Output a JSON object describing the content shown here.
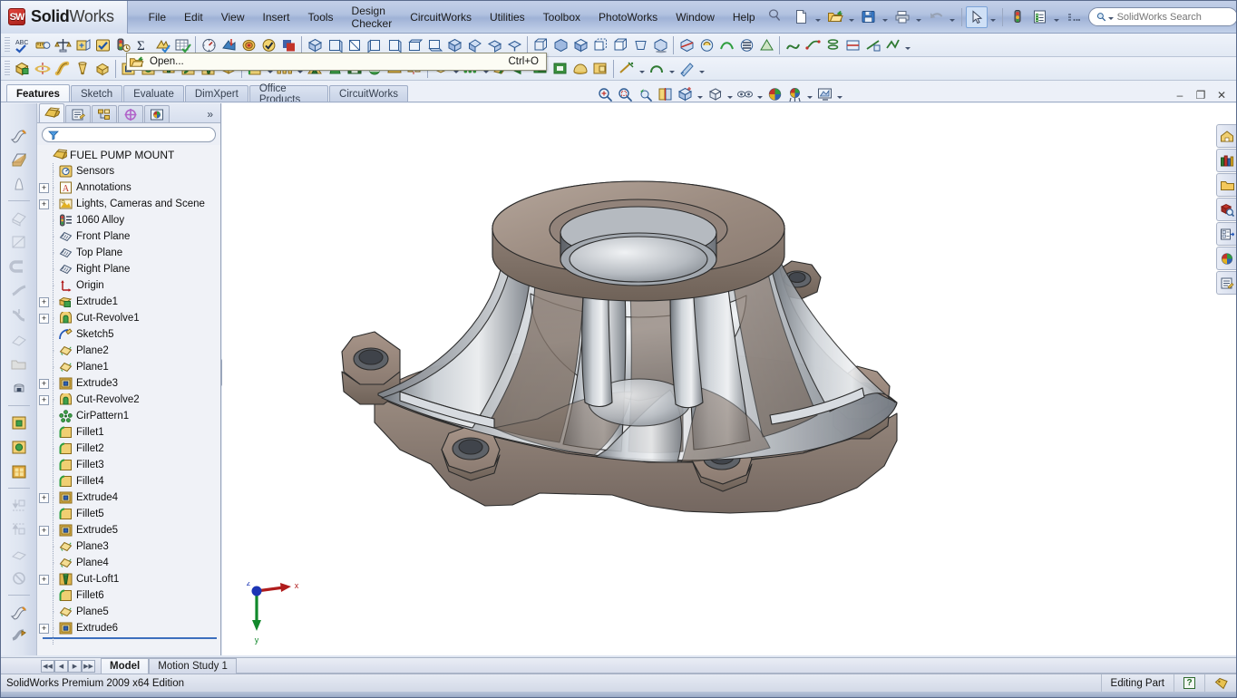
{
  "app": {
    "brand_bold": "Solid",
    "brand_light": "Works",
    "badge": "SW",
    "edition": "SolidWorks Premium 2009 x64 Edition"
  },
  "menubar": {
    "items": [
      {
        "label": "File"
      },
      {
        "label": "Edit"
      },
      {
        "label": "View"
      },
      {
        "label": "Insert"
      },
      {
        "label": "Tools"
      },
      {
        "label": "Design Checker"
      },
      {
        "label": "CircuitWorks"
      },
      {
        "label": "Utilities"
      },
      {
        "label": "Toolbox"
      },
      {
        "label": "PhotoWorks"
      },
      {
        "label": "Window"
      },
      {
        "label": "Help"
      }
    ]
  },
  "search": {
    "placeholder": "SolidWorks Search",
    "value": ""
  },
  "window_controls": {
    "help": "?",
    "help_caret": "▾",
    "minimize": "–",
    "restore": "❐",
    "close": "✕"
  },
  "quick_toolbar": {
    "items": [
      {
        "name": "new-document-icon",
        "label": "New"
      },
      {
        "name": "open-document-icon",
        "label": "Open"
      },
      {
        "name": "save-icon",
        "label": "Save"
      },
      {
        "name": "print-icon",
        "label": "Print"
      },
      {
        "name": "undo-icon",
        "label": "Undo"
      },
      {
        "name": "select-cursor-icon",
        "label": "Select"
      },
      {
        "name": "rebuild-icon",
        "label": "Rebuild"
      },
      {
        "name": "options-icon",
        "label": "Options"
      },
      {
        "name": "toolbar-overflow-icon",
        "label": "More"
      }
    ]
  },
  "tooltip": {
    "title": "Open...",
    "shortcut": "Ctrl+O"
  },
  "command_manager": {
    "tabs": [
      {
        "label": "Features",
        "active": true
      },
      {
        "label": "Sketch",
        "active": false
      },
      {
        "label": "Evaluate",
        "active": false
      },
      {
        "label": "DimXpert",
        "active": false
      },
      {
        "label": "Office Products",
        "active": false
      },
      {
        "label": "CircuitWorks",
        "active": false
      }
    ]
  },
  "tree_panel": {
    "tabs": [
      {
        "name": "feature-manager-tab",
        "label": "FeatureManager design tree",
        "active": true
      },
      {
        "name": "property-manager-tab",
        "label": "PropertyManager",
        "active": false
      },
      {
        "name": "configuration-manager-tab",
        "label": "ConfigurationManager",
        "active": false
      },
      {
        "name": "dimxpert-manager-tab",
        "label": "DimXpertManager",
        "active": false
      },
      {
        "name": "display-manager-tab",
        "label": "DisplayManager",
        "active": false
      }
    ],
    "more_label": "»",
    "filter": {
      "placeholder": "",
      "value": ""
    },
    "root": {
      "label": "FUEL PUMP MOUNT",
      "icon": "part-icon"
    },
    "items": [
      {
        "label": "Sensors",
        "icon": "sensor-icon",
        "expandable": false
      },
      {
        "label": "Annotations",
        "icon": "annotations-icon",
        "expandable": true
      },
      {
        "label": "Lights, Cameras and Scene",
        "icon": "lights-icon",
        "expandable": true
      },
      {
        "label": "1060 Alloy",
        "icon": "material-icon",
        "expandable": false
      },
      {
        "label": "Front Plane",
        "icon": "plane-icon",
        "expandable": false
      },
      {
        "label": "Top Plane",
        "icon": "plane-icon",
        "expandable": false
      },
      {
        "label": "Right Plane",
        "icon": "plane-icon",
        "expandable": false
      },
      {
        "label": "Origin",
        "icon": "origin-icon",
        "expandable": false
      },
      {
        "label": "Extrude1",
        "icon": "extrude-icon",
        "expandable": true
      },
      {
        "label": "Cut-Revolve1",
        "icon": "cut-revolve-icon",
        "expandable": true
      },
      {
        "label": "Sketch5",
        "icon": "sketch-icon",
        "expandable": false
      },
      {
        "label": "Plane2",
        "icon": "plane-gold-icon",
        "expandable": false
      },
      {
        "label": "Plane1",
        "icon": "plane-gold-icon",
        "expandable": false
      },
      {
        "label": "Extrude3",
        "icon": "extrude-cut-icon",
        "expandable": true
      },
      {
        "label": "Cut-Revolve2",
        "icon": "cut-revolve-icon",
        "expandable": true
      },
      {
        "label": "CirPattern1",
        "icon": "circular-pattern-icon",
        "expandable": false
      },
      {
        "label": "Fillet1",
        "icon": "fillet-icon",
        "expandable": false
      },
      {
        "label": "Fillet2",
        "icon": "fillet-icon",
        "expandable": false
      },
      {
        "label": "Fillet3",
        "icon": "fillet-icon",
        "expandable": false
      },
      {
        "label": "Fillet4",
        "icon": "fillet-icon",
        "expandable": false
      },
      {
        "label": "Extrude4",
        "icon": "extrude-cut-icon",
        "expandable": true
      },
      {
        "label": "Fillet5",
        "icon": "fillet-icon",
        "expandable": false
      },
      {
        "label": "Extrude5",
        "icon": "extrude-cut-icon",
        "expandable": true
      },
      {
        "label": "Plane3",
        "icon": "plane-gold-icon",
        "expandable": false
      },
      {
        "label": "Plane4",
        "icon": "plane-gold-icon",
        "expandable": false
      },
      {
        "label": "Cut-Loft1",
        "icon": "cut-loft-icon",
        "expandable": true
      },
      {
        "label": "Fillet6",
        "icon": "fillet-icon",
        "expandable": false
      },
      {
        "label": "Plane5",
        "icon": "plane-gold-icon",
        "expandable": false
      },
      {
        "label": "Extrude6",
        "icon": "extrude-cut-icon",
        "expandable": true
      }
    ]
  },
  "view_toolbar": {
    "items": [
      {
        "name": "zoom-to-fit-icon",
        "label": "Zoom to Fit"
      },
      {
        "name": "zoom-to-area-icon",
        "label": "Zoom to Area"
      },
      {
        "name": "previous-view-icon",
        "label": "Previous View"
      },
      {
        "name": "section-view-icon",
        "label": "Section View"
      },
      {
        "name": "view-orientation-icon",
        "label": "View Orientation",
        "caret": true
      },
      {
        "name": "display-style-icon",
        "label": "Display Style",
        "caret": true
      },
      {
        "name": "hide-show-items-icon",
        "label": "Hide/Show Items",
        "caret": true
      },
      {
        "name": "edit-appearance-icon",
        "label": "Edit Appearance"
      },
      {
        "name": "apply-scene-icon",
        "label": "Apply Scene",
        "caret": true
      },
      {
        "name": "view-settings-icon",
        "label": "View Settings",
        "caret": true
      }
    ]
  },
  "task_pane": {
    "items": [
      {
        "name": "solidworks-resources-icon",
        "label": "SolidWorks Resources"
      },
      {
        "name": "design-library-icon",
        "label": "Design Library"
      },
      {
        "name": "file-explorer-icon",
        "label": "File Explorer"
      },
      {
        "name": "search-pane-icon",
        "label": "SolidWorks Search"
      },
      {
        "name": "view-palette-icon",
        "label": "View Palette"
      },
      {
        "name": "appearances-scenes-icon",
        "label": "Appearances, Scenes and Decals"
      },
      {
        "name": "custom-properties-icon",
        "label": "Custom Properties"
      }
    ]
  },
  "bottom_tabs": {
    "nav": [
      "◀◀",
      "◀",
      "▶",
      "▶▶"
    ],
    "tabs": [
      {
        "label": "Model",
        "active": true
      },
      {
        "label": "Motion Study 1",
        "active": false
      }
    ]
  },
  "statusbar": {
    "message": "SolidWorks Premium 2009 x64 Edition",
    "mode": "Editing Part",
    "help_badge": "?",
    "tag_icon": "tag-icon"
  },
  "graphics": {
    "window_controls": {
      "minimize": "–",
      "restore": "❐",
      "close": "✕"
    },
    "triad": {
      "x_label": "x",
      "y_label": "y",
      "z_label": "z",
      "x_color": "#b01c1c",
      "y_color": "#12892c",
      "z_color": "#1c35b5"
    },
    "model_colors": {
      "cast_face": "#9e8e85",
      "machined_face": "#b8bcc0",
      "highlight": "#e8eaec",
      "edge": "#2b2b2b"
    }
  }
}
